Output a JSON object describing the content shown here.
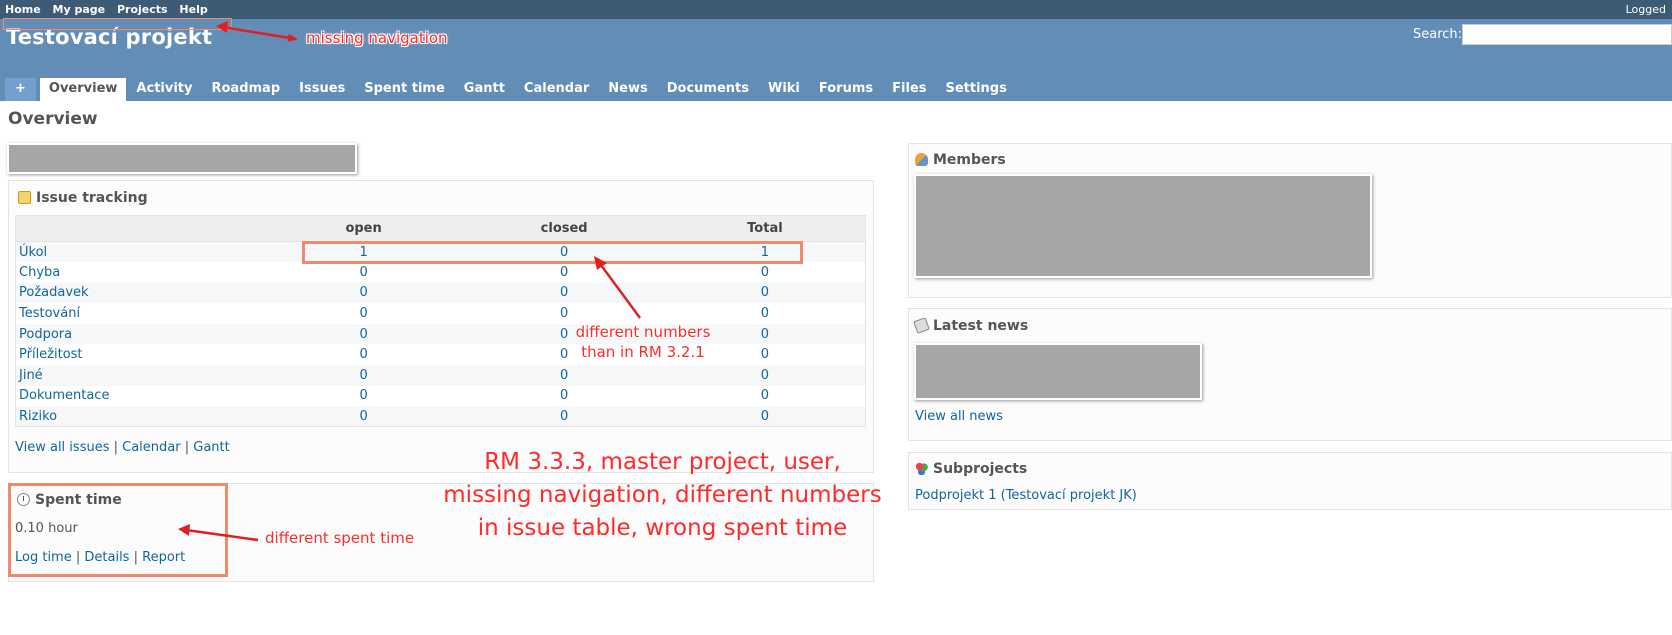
{
  "top_menu": {
    "items": [
      "Home",
      "My page",
      "Projects",
      "Help"
    ],
    "logged": "Logged"
  },
  "header": {
    "title": "Testovací projekt",
    "search_label": "Search:",
    "search_value": ""
  },
  "main_menu": {
    "plus": "+",
    "tabs": [
      "Overview",
      "Activity",
      "Roadmap",
      "Issues",
      "Spent time",
      "Gantt",
      "Calendar",
      "News",
      "Documents",
      "Wiki",
      "Forums",
      "Files",
      "Settings"
    ],
    "selected": "Overview"
  },
  "page_title": "Overview",
  "issue_tracking": {
    "title": "Issue tracking",
    "columns": [
      "",
      "open",
      "closed",
      "Total"
    ],
    "rows": [
      {
        "name": "Úkol",
        "open": "1",
        "closed": "0",
        "total": "1"
      },
      {
        "name": "Chyba",
        "open": "0",
        "closed": "0",
        "total": "0"
      },
      {
        "name": "Požadavek",
        "open": "0",
        "closed": "0",
        "total": "0"
      },
      {
        "name": "Testování",
        "open": "0",
        "closed": "0",
        "total": "0"
      },
      {
        "name": "Podpora",
        "open": "0",
        "closed": "0",
        "total": "0"
      },
      {
        "name": "Příležitost",
        "open": "0",
        "closed": "0",
        "total": "0"
      },
      {
        "name": "Jiné",
        "open": "0",
        "closed": "0",
        "total": "0"
      },
      {
        "name": "Dokumentace",
        "open": "0",
        "closed": "0",
        "total": "0"
      },
      {
        "name": "Riziko",
        "open": "0",
        "closed": "0",
        "total": "0"
      }
    ],
    "links": [
      "View all issues",
      "Calendar",
      "Gantt"
    ]
  },
  "spent_time": {
    "title": "Spent time",
    "value": "0.10 hour",
    "links": [
      "Log time",
      "Details",
      "Report"
    ]
  },
  "members": {
    "title": "Members"
  },
  "latest_news": {
    "title": "Latest news",
    "link": "View all news"
  },
  "subprojects": {
    "title": "Subprojects",
    "item": "Podprojekt 1 (Testovací projekt JK)"
  },
  "annotations": {
    "missing_navigation": "missing navigation",
    "different_numbers_1": "different numbers",
    "different_numbers_2": "than in RM 3.2.1",
    "different_spent": "different spent time",
    "summary_1": "RM 3.3.3, master project, user,",
    "summary_2": "missing navigation, different numbers",
    "summary_3": "in issue table, wrong spent time",
    "color": "#ff2a2a",
    "box_color": "#ef8a6a"
  },
  "colors": {
    "top_menu": "#3e5b76",
    "header": "#628db6",
    "link": "#169"
  }
}
